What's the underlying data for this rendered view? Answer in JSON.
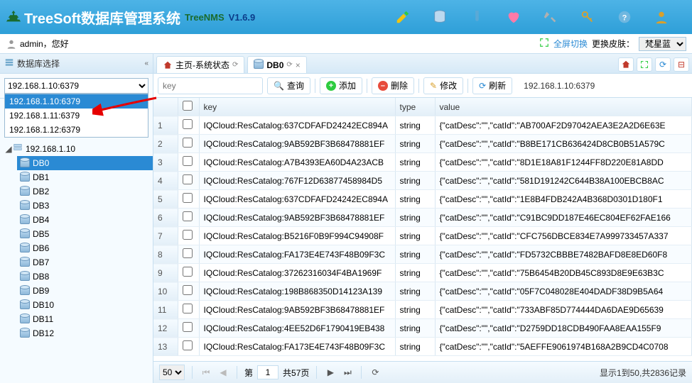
{
  "header": {
    "title": "TreeSoft数据库管理系统",
    "subtitle": "TreeNMS",
    "version": "V1.6.9"
  },
  "userbar": {
    "greeting": "admin，您好",
    "fullscreen": "全屏切换",
    "skin_label": "更换皮肤：",
    "skin_options": [
      "梵星蓝"
    ],
    "skin_selected": "梵星蓝"
  },
  "sidebar": {
    "title": "数据库选择",
    "combo_selected": "192.168.1.10:6379",
    "combo_options": [
      "192.168.1.10:6379",
      "192.168.1.11:6379",
      "192.168.1.12:6379"
    ],
    "tree_root": "192.168.1.10",
    "tree_children": [
      "DB0",
      "DB1",
      "DB2",
      "DB3",
      "DB4",
      "DB5",
      "DB6",
      "DB7",
      "DB8",
      "DB9",
      "DB10",
      "DB11",
      "DB12"
    ],
    "tree_active_index": 0
  },
  "tabs": [
    {
      "label": "主页-系统状态",
      "icon": "home",
      "closable": false
    },
    {
      "label": "DB0",
      "icon": "db",
      "closable": true,
      "active": true
    }
  ],
  "toolbar": {
    "search_placeholder": "key",
    "query": "查询",
    "add": "添加",
    "delete": "删除",
    "edit": "修改",
    "refresh": "刷新",
    "conn": "192.168.1.10:6379"
  },
  "grid": {
    "columns": [
      "",
      "",
      "key",
      "type",
      "value"
    ],
    "rows": [
      {
        "key": "IQCloud:ResCatalog:637CDFAFD24242EC894A",
        "type": "string",
        "value": "{\"catDesc\":\"\",\"catId\":\"AB700AF2D97042AEA3E2A2D6E63E"
      },
      {
        "key": "IQCloud:ResCatalog:9AB592BF3B68478881EF",
        "type": "string",
        "value": "{\"catDesc\":\"\",\"catId\":\"B8BE171CB636424D8CB0B51A579C"
      },
      {
        "key": "IQCloud:ResCatalog:A7B4393EA60D4A23ACB",
        "type": "string",
        "value": "{\"catDesc\":\"\",\"catId\":\"8D1E18A81F1244FF8D220E81A8DD"
      },
      {
        "key": "IQCloud:ResCatalog:767F12D63877458984D5",
        "type": "string",
        "value": "{\"catDesc\":\"\",\"catId\":\"581D191242C644B38A100EBCB8AC"
      },
      {
        "key": "IQCloud:ResCatalog:637CDFAFD24242EC894A",
        "type": "string",
        "value": "{\"catDesc\":\"\",\"catId\":\"1E8B4FDB242A4B368D0301D180F1"
      },
      {
        "key": "IQCloud:ResCatalog:9AB592BF3B68478881EF",
        "type": "string",
        "value": "{\"catDesc\":\"\",\"catId\":\"C91BC9DD187E46EC804EF62FAE166"
      },
      {
        "key": "IQCloud:ResCatalog:B5216F0B9F994C94908F",
        "type": "string",
        "value": "{\"catDesc\":\"\",\"catId\":\"CFC756DBCE834E7A999733457A337"
      },
      {
        "key": "IQCloud:ResCatalog:FA173E4E743F48B09F3C",
        "type": "string",
        "value": "{\"catDesc\":\"\",\"catId\":\"FD5732CBBBE7482BAFD8E8ED60F8"
      },
      {
        "key": "IQCloud:ResCatalog:37262316034F4BA1969F",
        "type": "string",
        "value": "{\"catDesc\":\"\",\"catId\":\"75B6454B20DB45C893D8E9E63B3C"
      },
      {
        "key": "IQCloud:ResCatalog:198B868350D14123A139",
        "type": "string",
        "value": "{\"catDesc\":\"\",\"catId\":\"05F7C048028E404DADF38D9B5A64"
      },
      {
        "key": "IQCloud:ResCatalog:9AB592BF3B68478881EF",
        "type": "string",
        "value": "{\"catDesc\":\"\",\"catId\":\"733ABF85D774444DA6DAE9D65639"
      },
      {
        "key": "IQCloud:ResCatalog:4EE52D6F1790419EB438",
        "type": "string",
        "value": "{\"catDesc\":\"\",\"catId\":\"D2759DD18CDB490FAA8EAA155F9"
      },
      {
        "key": "IQCloud:ResCatalog:FA173E4E743F48B09F3C",
        "type": "string",
        "value": "{\"catDesc\":\"\",\"catId\":\"5AEFFE9061974B168A2B9CD4C0708"
      }
    ]
  },
  "pager": {
    "page_size": "50",
    "page_label_pre": "第",
    "page": "1",
    "page_label_post": "共57页",
    "summary": "显示1到50,共2836记录"
  }
}
